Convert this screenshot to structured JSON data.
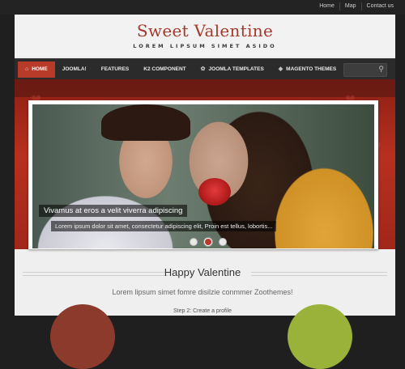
{
  "top_links": [
    "Home",
    "Map",
    "Contact us"
  ],
  "header": {
    "site_title": "Sweet Valentine",
    "tagline": "LOREM LIPSUM SIMET ASIDO"
  },
  "nav": {
    "items": [
      "HOME",
      "JOOMLA!",
      "FEATURES",
      "K2 COMPONENT",
      "JOOMLA TEMPLATES",
      "MAGENTO THEMES"
    ],
    "active": "HOME"
  },
  "slider": {
    "caption_title": "Vivamus at eros a velit viverra adipiscing",
    "caption_text": "Lorem ipsum dolor sit amet, consectetur adipiscing elit, Proin est tellus, lobortis...",
    "slide_count": 3,
    "active_slide": 2
  },
  "section": {
    "title": "Happy Valentine",
    "subtitle": "Lorem lipsum simet fomre disilzie conmmer Zoothemes!",
    "step_text": "Step 2: Create a profile"
  },
  "colors": {
    "accent": "#b83a28",
    "title": "#a3392b",
    "nav_bg": "#2b2b2b"
  },
  "icons": {
    "home": "home-icon",
    "search": "search-icon"
  }
}
